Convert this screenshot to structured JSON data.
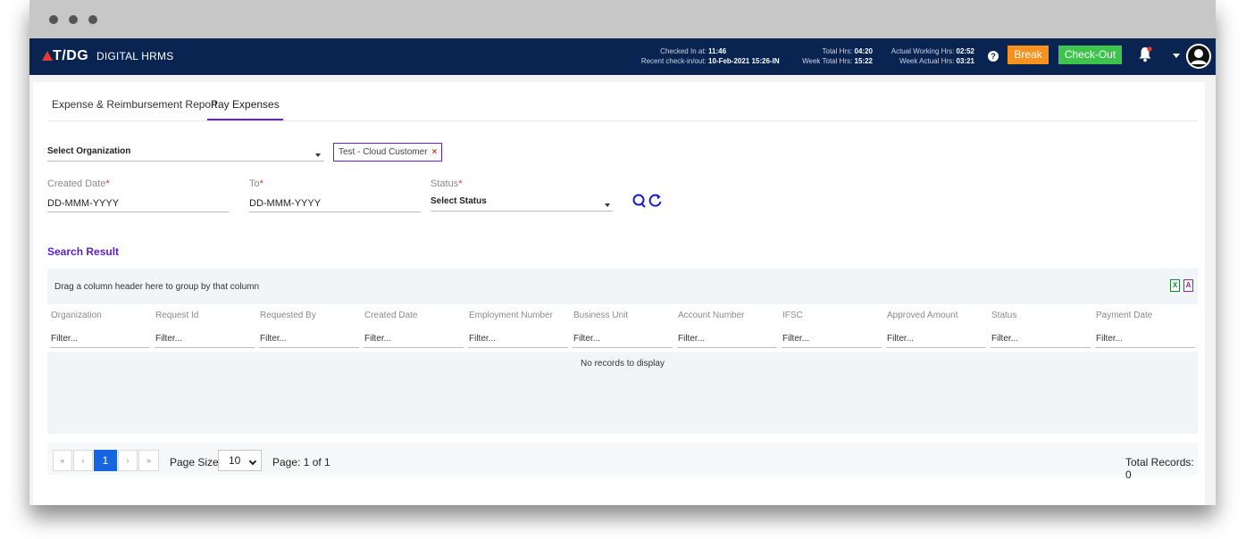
{
  "header": {
    "logo": "T/DG",
    "app_name": "DIGITAL HRMS",
    "checked_in_label": "Checked In at:",
    "checked_in_value": "11:46",
    "recent_label": "Recent check-in/out:",
    "recent_value": "10-Feb-2021 15:26-IN",
    "total_hrs_label": "Total Hrs:",
    "total_hrs_value": "04:20",
    "week_total_label": "Week Total Hrs:",
    "week_total_value": "15:22",
    "actual_working_label": "Actual Working Hrs:",
    "actual_working_value": "02:52",
    "week_actual_label": "Week Actual Hrs:",
    "week_actual_value": "03:21",
    "help_glyph": "?",
    "break_label": "Break",
    "checkout_label": "Check-Out",
    "colors": {
      "bar": "#0a2452",
      "break": "#f5921e",
      "checkout": "#3ec34d"
    }
  },
  "tabs": [
    {
      "label": "Expense & Reimbursement Report",
      "active": false
    },
    {
      "label": "Pay Expenses",
      "active": true
    }
  ],
  "filters": {
    "organization_placeholder": "Select Organization",
    "organization_chip": "Test - Cloud Customer",
    "chip_remove": "×",
    "created_date_label": "Created Date",
    "created_date_value": "DD-MMM-YYYY",
    "to_label": "To",
    "to_value": "DD-MMM-YYYY",
    "status_label": "Status",
    "status_value": "Select Status",
    "required_mark": "*"
  },
  "results": {
    "title": "Search Result",
    "group_hint": "Drag a column header here to group by that column",
    "columns": [
      "Organization",
      "Request Id",
      "Requested By",
      "Created Date",
      "Employment Number",
      "Business Unit",
      "Account Number",
      "IFSC",
      "Approved Amount",
      "Status",
      "Payment Date"
    ],
    "filter_placeholder": "Filter...",
    "empty_message": "No records to display",
    "export_excel": "X",
    "export_pdf": "A"
  },
  "pager": {
    "first": "«",
    "prev": "‹",
    "current": "1",
    "next": "›",
    "last": "»",
    "page_size_label": "Page Size:",
    "page_size_value": "10",
    "page_info": "Page: 1 of 1",
    "total_records": "Total Records: 0"
  }
}
